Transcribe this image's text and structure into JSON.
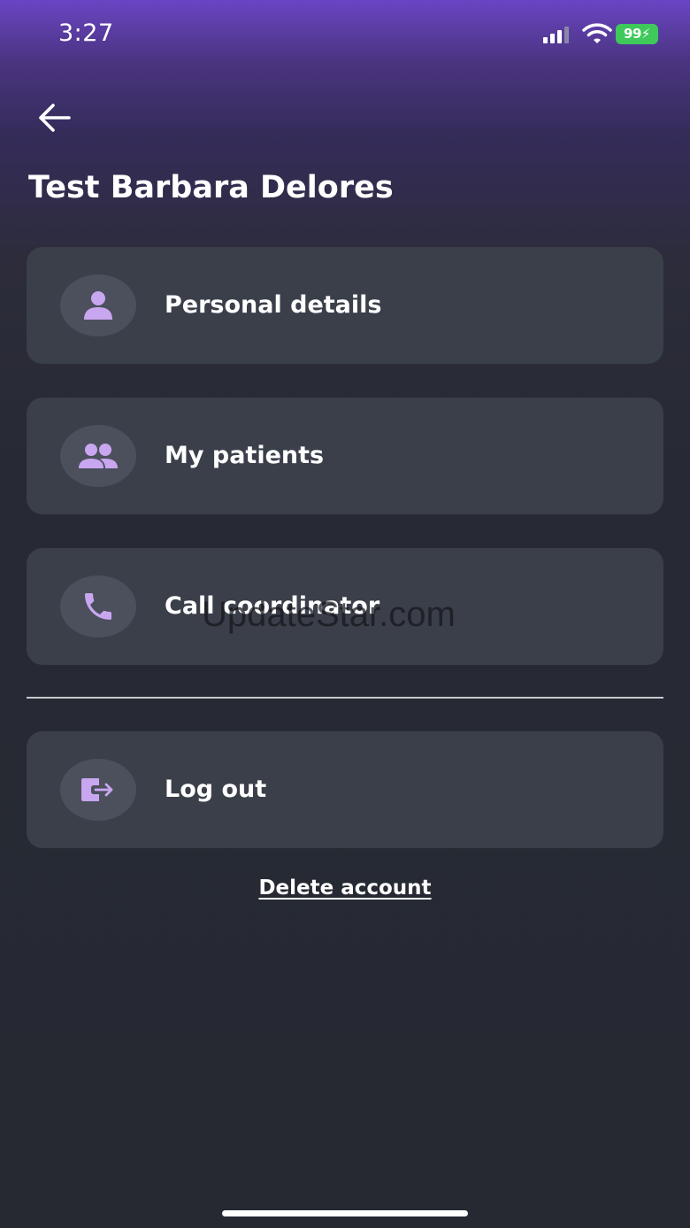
{
  "status_bar": {
    "time": "3:27",
    "battery_level": "99",
    "signal_icon": "cellular-signal-icon",
    "wifi_icon": "wifi-icon",
    "battery_icon": "battery-charging-icon",
    "battery_color": "#3ec95a"
  },
  "header": {
    "back_icon": "arrow-left-icon",
    "title": "Test Barbara Delores"
  },
  "menu": {
    "items": [
      {
        "label": "Personal details",
        "icon": "person-icon"
      },
      {
        "label": "My patients",
        "icon": "people-icon"
      },
      {
        "label": "Call coordinator",
        "icon": "phone-icon"
      }
    ]
  },
  "logout": {
    "label": "Log out",
    "icon": "logout-icon"
  },
  "delete_account": {
    "label": "Delete account"
  },
  "watermark": "UpdateStar.com",
  "colors": {
    "accent_purple": "#c9a6f0",
    "card_background": "#3a3f4a",
    "icon_circle": "#4b505c",
    "background_top": "#6a45c4",
    "background_bottom": "#262932"
  }
}
